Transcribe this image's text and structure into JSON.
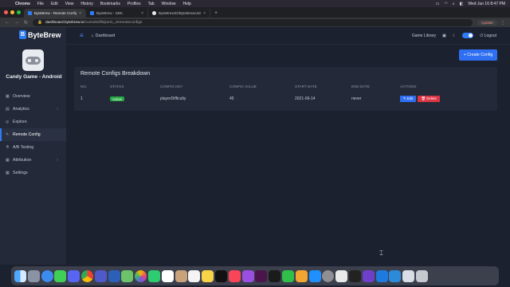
{
  "menubar": {
    "app": "Chrome",
    "items": [
      "File",
      "Edit",
      "View",
      "History",
      "Bookmarks",
      "Profiles",
      "Tab",
      "Window",
      "Help"
    ],
    "clock": "Wed Jun 16  8:47 PM"
  },
  "browser": {
    "tabs": [
      {
        "label": "ByteBrew - Remote Configs",
        "active": true,
        "color": "#2f7df6"
      },
      {
        "label": "ByteBrew - SDK",
        "active": false,
        "color": "#2f7df6"
      },
      {
        "label": "ByteBrewIO/ByteBrewUnitySDK",
        "active": false,
        "color": "#e8eaed"
      }
    ],
    "url_host": "dashboard.bytebrew.io",
    "url_path": "/console/l/l6jUeG_o/remoteconfigs",
    "update_label": "Update"
  },
  "sidebar": {
    "brand": "ByteBrew",
    "app_name": "Candy Game - Android",
    "items": [
      {
        "label": "Overview",
        "icon": "grid-icon",
        "glyph": "▦",
        "chevron": false
      },
      {
        "label": "Analytics",
        "icon": "chart-icon",
        "glyph": "▤",
        "chevron": true
      },
      {
        "label": "Explore",
        "icon": "compass-icon",
        "glyph": "◎",
        "chevron": false
      },
      {
        "label": "Remote Config",
        "icon": "wrench-icon",
        "glyph": "✎",
        "chevron": false,
        "active": true
      },
      {
        "label": "A/B Testing",
        "icon": "flask-icon",
        "glyph": "⚗",
        "chevron": false
      },
      {
        "label": "Attribution",
        "icon": "link-icon",
        "glyph": "▦",
        "chevron": true
      },
      {
        "label": "Settings",
        "icon": "gear-icon",
        "glyph": "▦",
        "chevron": false
      }
    ]
  },
  "header": {
    "breadcrumb": "Dashboard",
    "game_library": "Game Library",
    "logout": "Logout"
  },
  "main": {
    "create_button": "+ Create Config",
    "card_title": "Remote Configs Breakdown",
    "columns": [
      "NO.",
      "STATUS",
      "CONFIG KEY",
      "CONFIG VALUE",
      "START DATE",
      "END DATE",
      "ACTIONS"
    ],
    "rows": [
      {
        "no": "1",
        "status": "Active",
        "key": "playerDifficulty",
        "value": "45",
        "start": "2021-06-14",
        "end": "never",
        "edit": "✎ Edit",
        "delete": "🗑 Delete"
      }
    ]
  },
  "colors": {
    "accent": "#2f6ff2",
    "active_badge": "#27a844",
    "delete": "#dc3545",
    "background": "#1c2130",
    "card": "#232938"
  },
  "dock": {
    "icons": [
      "finder",
      "launchpad",
      "safari",
      "messages",
      "discord",
      "chrome",
      "teams",
      "word",
      "maps",
      "photos",
      "facetime",
      "calendar",
      "contacts",
      "reminders",
      "notes",
      "apple-tv",
      "music",
      "podcasts",
      "slack",
      "stocks",
      "numbers",
      "keynote",
      "app-store",
      "system-preferences",
      "unity",
      "terminal",
      "github",
      "xcode",
      "vscode",
      "preview",
      "trash"
    ]
  }
}
